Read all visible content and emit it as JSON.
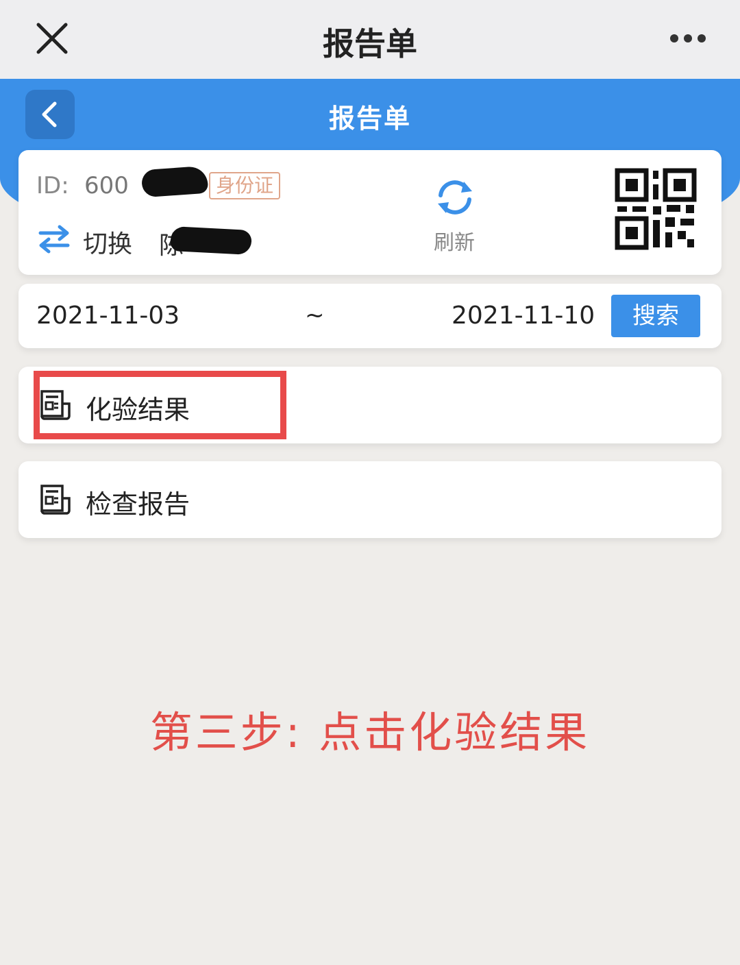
{
  "top_bar": {
    "title": "报告单",
    "close_icon": "close-icon",
    "more_icon": "more-icon"
  },
  "header": {
    "title": "报告单",
    "back_icon": "chevron-left-icon",
    "color": "#3b90e8"
  },
  "patient": {
    "id_label": "ID:",
    "id_value": "600",
    "id_type_badge": "身份证",
    "switch_label": "切换",
    "name": "陈",
    "refresh_label": "刷新",
    "qr_icon": "qr-code-icon"
  },
  "date_range": {
    "start": "2021-11-03",
    "separator": "~",
    "end": "2021-11-10",
    "search_label": "搜索"
  },
  "menu": [
    {
      "label": "化验结果",
      "icon": "document-icon"
    },
    {
      "label": "检查报告",
      "icon": "document-icon"
    }
  ],
  "annotation": {
    "instruction": "第三步: 点击化验结果",
    "highlight_color": "#e84a4a"
  }
}
